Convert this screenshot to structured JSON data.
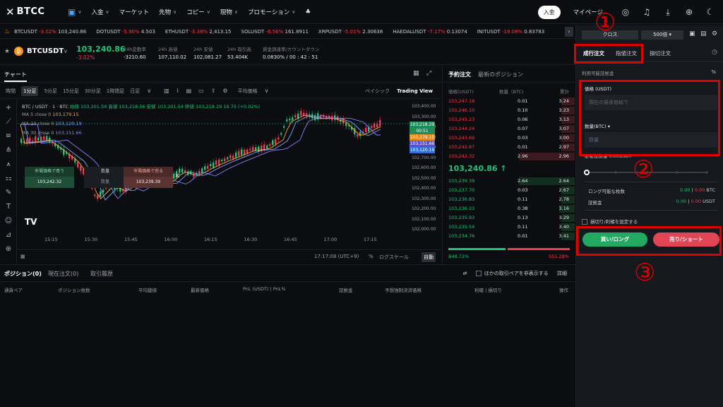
{
  "header": {
    "logo": "BTCC",
    "nav": [
      {
        "label": "入金",
        "chev": true
      },
      {
        "label": "マーケット",
        "chev": false
      },
      {
        "label": "先物",
        "chev": true
      },
      {
        "label": "コピー",
        "chev": true
      },
      {
        "label": "現物",
        "chev": true
      },
      {
        "label": "プロモーション",
        "chev": true
      }
    ],
    "deposit_button": "入金",
    "mypage": "マイページ"
  },
  "ticker": [
    {
      "sym": "BTCUSDT",
      "chg": "-3.02%",
      "price": "103,240.86"
    },
    {
      "sym": "DOTUSDT",
      "chg": "-5.90%",
      "price": "4.503"
    },
    {
      "sym": "ETHUSDT",
      "chg": "-3.38%",
      "price": "2,413.15"
    },
    {
      "sym": "SOLUSDT",
      "chg": "-6.56%",
      "price": "161.8911"
    },
    {
      "sym": "XRPUSDT",
      "chg": "-5.01%",
      "price": "2.30638"
    },
    {
      "sym": "HAEDALUSDT",
      "chg": "-7.17%",
      "price": "0.13074"
    },
    {
      "sym": "INITUSDT",
      "chg": "-18.08%",
      "price": "0.83783"
    }
  ],
  "symbol": {
    "name": "BTCUSDT",
    "last": "103,240.86",
    "change": "-3.02%",
    "stats": [
      {
        "label": "24h変動率",
        "value": "-3210.60",
        "neg": true
      },
      {
        "label": "24h 高値",
        "value": "107,110.02",
        "neg": false
      },
      {
        "label": "24h 安値",
        "value": "102,081.27",
        "neg": false
      },
      {
        "label": "24h 取引高",
        "value": "53.404K",
        "neg": false
      },
      {
        "label": "資金調達率/カウントダウン",
        "value": "0.0830% / 00 : 42 : 51",
        "neg": false
      }
    ]
  },
  "chart": {
    "tab": "チャート",
    "timeframes": [
      "時間",
      "1分足",
      "5分足",
      "15分足",
      "30分足",
      "1時間足",
      "日足"
    ],
    "active_tf": "1分足",
    "indicator": "平均価格",
    "basic": "ベイシック",
    "tradingview": "Trading View",
    "ohlc_prefix": "BTC / USDT · 1 · BTC",
    "ohlc": "始値 103,201.54  高値 103,218.56  安値 103,201.54  終値 103,218.29  16.75 (+0.02%)",
    "ma": [
      {
        "label": "MA 5 close 0",
        "value": "103,179.15",
        "color": "y"
      },
      {
        "label": "MA 10 close 0",
        "value": "103,120.19",
        "color": "b1"
      },
      {
        "label": "MA 30 close 0",
        "value": "103,151.66",
        "color": "b2"
      }
    ],
    "buy_box": {
      "title": "市場価格で買う",
      "price": "103,242.32"
    },
    "qty_box": {
      "title": "数量",
      "value": "数量"
    },
    "sell_box": {
      "title": "市場価格で売る",
      "price": "103,239.39"
    },
    "price_axis": [
      "103,400.00",
      "103,300.00",
      "103,100.00",
      "102,900.00",
      "102,800.00",
      "102,700.00",
      "102,600.00",
      "102,500.00",
      "102,400.00",
      "102,300.00",
      "102,200.00",
      "102,100.00",
      "102,000.00"
    ],
    "price_tags": [
      {
        "text": "103,218.29",
        "color": "#1f8a5a"
      },
      {
        "text": "00:51",
        "color": "#1f8a5a"
      },
      {
        "text": "103,179.15",
        "color": "#e08a1e"
      },
      {
        "text": "103,151.66",
        "color": "#5b4fd6"
      },
      {
        "text": "103,120.19",
        "color": "#2f6fd6"
      }
    ],
    "time_axis": [
      "15:15",
      "15:30",
      "15:45",
      "16:00",
      "16:15",
      "16:30",
      "16:45",
      "17:00",
      "17:15"
    ],
    "footer_time": "17:17:08 (UTC+9)",
    "pct": "%",
    "log": "ログスケール",
    "auto": "自動"
  },
  "book": {
    "tabs": [
      "予約注文",
      "最新のポジション"
    ],
    "cols": [
      "価格(USDT)",
      "数量（BTC)",
      "累計"
    ],
    "asks": [
      {
        "p": "103,247.18",
        "q": "0.01",
        "t": "3.24",
        "w": 0.1
      },
      {
        "p": "103,246.10",
        "q": "0.10",
        "t": "3.23",
        "w": 0.1
      },
      {
        "p": "103,245.23",
        "q": "0.06",
        "t": "3.13",
        "w": 0.1
      },
      {
        "p": "103,244.24",
        "q": "0.07",
        "t": "3.07",
        "w": 0.1
      },
      {
        "p": "103,243.69",
        "q": "0.03",
        "t": "3.00",
        "w": 0.1
      },
      {
        "p": "103,242.87",
        "q": "0.01",
        "t": "2.97",
        "w": 0.1
      },
      {
        "p": "103,242.32",
        "q": "2.96",
        "t": "2.96",
        "w": 0.42
      }
    ],
    "mid": "103,240.86 ↑",
    "bids": [
      {
        "p": "103,239.39",
        "q": "2.64",
        "t": "2.64",
        "w": 0.42
      },
      {
        "p": "103,237.70",
        "q": "0.03",
        "t": "2.67",
        "w": 0.1
      },
      {
        "p": "103,236.83",
        "q": "0.11",
        "t": "2.78",
        "w": 0.1
      },
      {
        "p": "103,236.23",
        "q": "0.38",
        "t": "3.16",
        "w": 0.12
      },
      {
        "p": "103,235.93",
        "q": "0.13",
        "t": "3.29",
        "w": 0.1
      },
      {
        "p": "103,235.54",
        "q": "0.11",
        "t": "3.40",
        "w": 0.1
      },
      {
        "p": "103,234.76",
        "q": "0.01",
        "t": "3.41",
        "w": 0.1
      }
    ],
    "buy_ratio": "B48.72%",
    "sell_ratio": "S51.28%"
  },
  "bottom": {
    "tabs": [
      "ポジション(0)",
      "現在注文(0)",
      "取引履歴"
    ],
    "hide_pairs": "ほかの取引ペアを非表示する",
    "detail": "詳細",
    "cols": [
      "通貨ペア",
      "ポジション枚数",
      "平均建値",
      "最新価格",
      "PnL (USDT) | PnL%",
      "証拠金",
      "予想強制決済価格",
      "利確 | 損切り",
      "操作"
    ]
  },
  "panel": {
    "cross": "クロス",
    "leverage": "500倍",
    "tabs": [
      "成行注文",
      "指値注文",
      "損切注文"
    ],
    "margin_label": "利用可能証拠金",
    "pct": "%",
    "price_label": "価格 (USDT)",
    "price_placeholder": "現在の最善価格で",
    "qty_label": "数量(BTC)",
    "qty_placeholder": "数量",
    "avail": "必要証拠金 0.00USDT",
    "long_label": "ロング可能な枚数",
    "long_val": "0.00",
    "short_val": "0.00",
    "long_unit": "BTC",
    "margin2_label": "証拠金",
    "m_long": "0.00",
    "m_short": "0.00",
    "m_unit": "USDT",
    "tpsl": "損切り/利確を設定する",
    "buy": "買い/ロング",
    "sell": "売り/ショート"
  },
  "annotations": [
    "①",
    "②",
    "③"
  ]
}
